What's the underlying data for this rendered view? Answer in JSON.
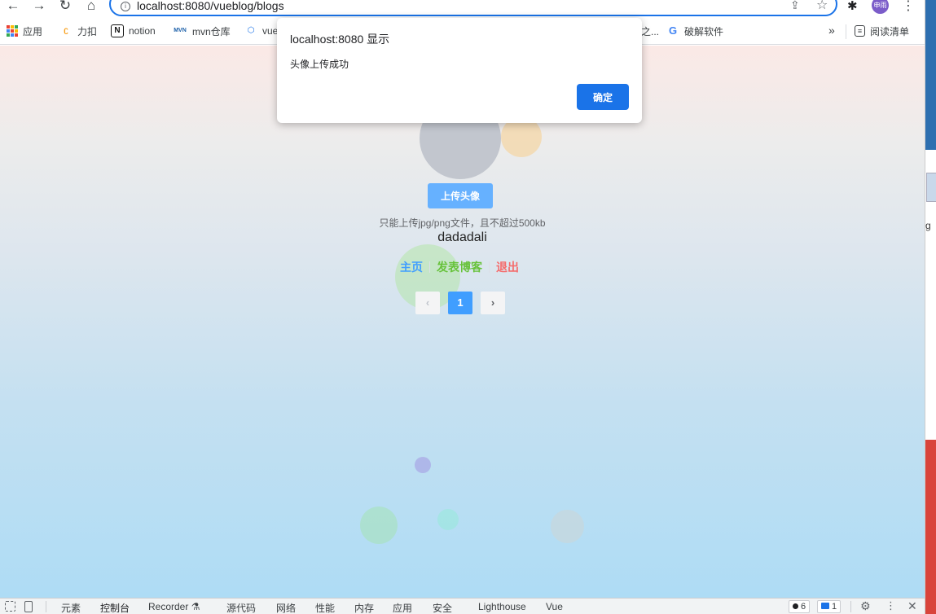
{
  "browser": {
    "url": "localhost:8080/vueblog/blogs",
    "avatar_text": "申雨"
  },
  "bookmarks": [
    {
      "label": "应用",
      "icon": "apps-grid-icon"
    },
    {
      "label": "力扣",
      "icon": "leetcode-icon"
    },
    {
      "label": "notion",
      "icon": "notion-icon"
    },
    {
      "label": "mvn仓库",
      "icon": "mvn-icon"
    },
    {
      "label": "vue",
      "icon": "vue-icon"
    },
    {
      "label": "之...",
      "icon": ""
    },
    {
      "label": "破解软件",
      "icon": "google-icon"
    }
  ],
  "bookmarks_overflow": "»",
  "reading_list": "阅读清单",
  "dialog": {
    "title": "localhost:8080 显示",
    "message": "头像上传成功",
    "ok_label": "确定"
  },
  "profile": {
    "upload_button": "上传头像",
    "upload_tip": "只能上传jpg/png文件，且不超过500kb",
    "username": "dadadali"
  },
  "nav": {
    "home": "主页",
    "publish": "发表博客",
    "exit": "退出"
  },
  "pagination": {
    "prev": "‹",
    "current": "1",
    "next": "›"
  },
  "right_edge_text": "g",
  "devtools": {
    "tabs": [
      "元素",
      "控制台",
      "Recorder ⚗",
      "源代码",
      "网络",
      "性能",
      "内存",
      "应用",
      "安全",
      "Lighthouse",
      "Vue"
    ],
    "active_tab": "控制台",
    "errors_badge": "6",
    "messages_badge": "1"
  },
  "colors": {
    "home_link": "#409eff",
    "publish_link": "#67c23a",
    "exit_link": "#f56c6c",
    "dialog_button": "#1a73e8"
  }
}
